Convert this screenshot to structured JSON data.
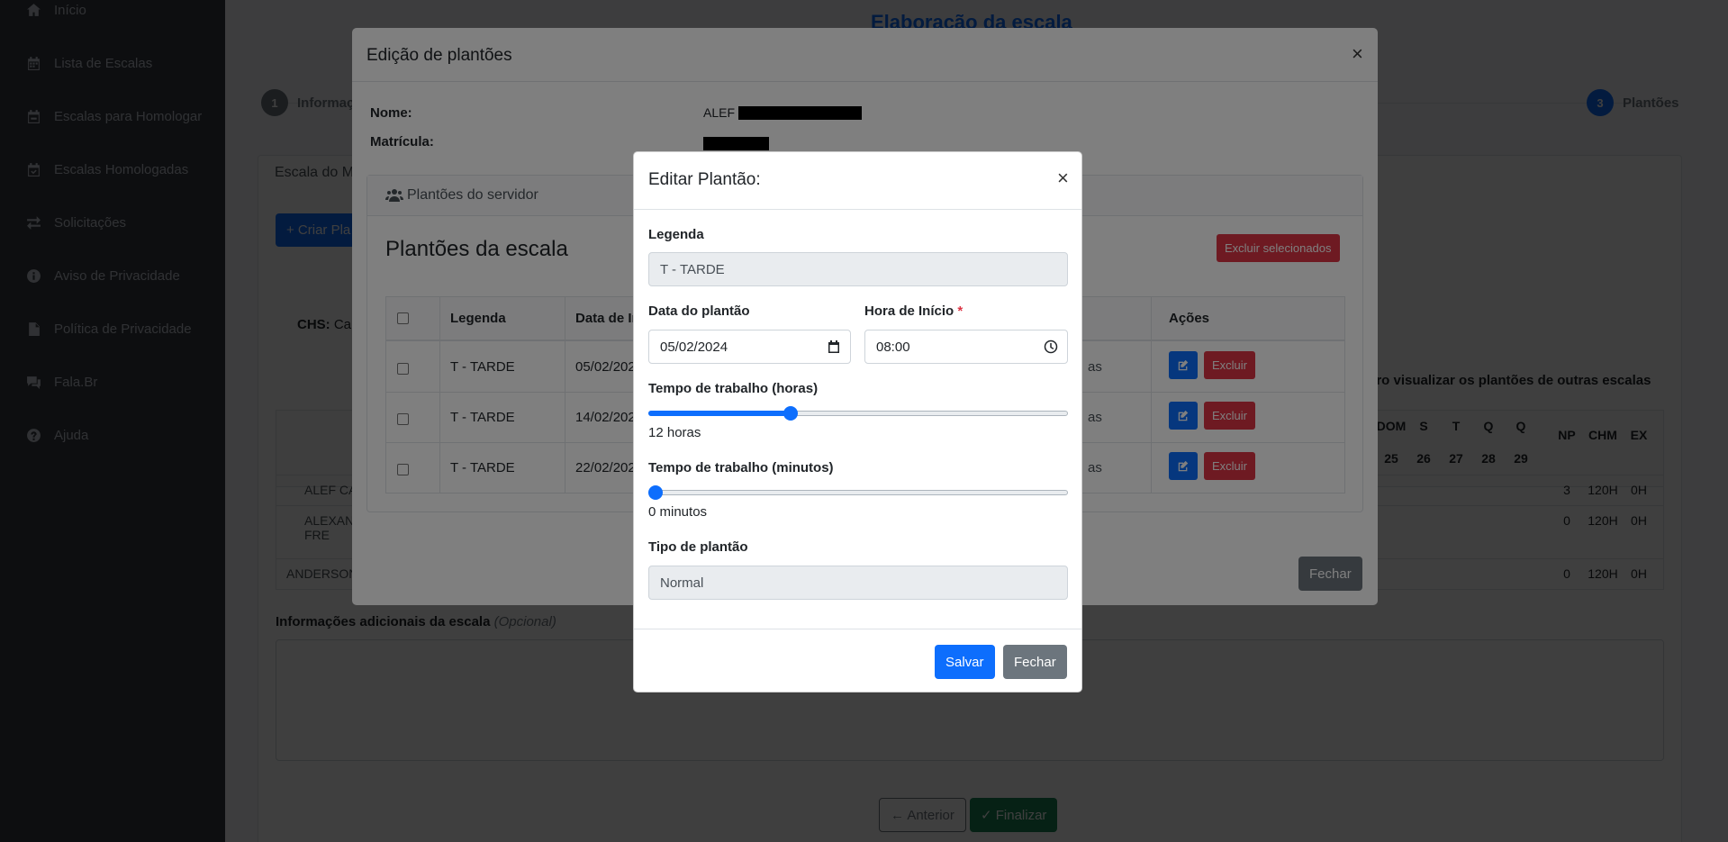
{
  "sidebar": {
    "items": [
      {
        "label": "Início",
        "icon": "home-icon"
      },
      {
        "label": "Lista de Escalas",
        "icon": "calendar-icon"
      },
      {
        "label": "Escalas para Homologar",
        "icon": "calendar-icon"
      },
      {
        "label": "Escalas Homologadas",
        "icon": "calendar-check-icon"
      },
      {
        "label": "Solicitações",
        "icon": "exchange-icon"
      },
      {
        "label": "Aviso de Privacidade",
        "icon": "info-icon"
      },
      {
        "label": "Política de Privacidade",
        "icon": "file-icon"
      },
      {
        "label": "Fala.Br",
        "icon": "comments-icon"
      },
      {
        "label": "Ajuda",
        "icon": "question-icon"
      }
    ]
  },
  "page": {
    "title": "Elaboração da escala",
    "steps": [
      {
        "num": "1",
        "label": "Informações"
      },
      {
        "num": "3",
        "label": "Plantões"
      }
    ],
    "tab": "Escala do M",
    "create_button": "+ Criar Pla",
    "chs_label": "CHS:",
    "chs_value": "Car",
    "other_scales_note": "ero visualizar os plantões de outras escalas",
    "calendar_days": [
      {
        "day": "DOM",
        "date": "25"
      },
      {
        "day": "S",
        "date": "26"
      },
      {
        "day": "T",
        "date": "27"
      },
      {
        "day": "Q",
        "date": "28"
      },
      {
        "day": "Q",
        "date": "29"
      }
    ],
    "summary_headers": [
      "NP",
      "CHM",
      "EX"
    ],
    "rows": [
      {
        "name": "ALEF CA",
        "np": "3",
        "chm": "120H",
        "ex": "0H"
      },
      {
        "name": "ALEXAN\nFRE",
        "np": "0",
        "chm": "120H",
        "ex": "0H"
      },
      {
        "name": "ANDERSON",
        "np": "0",
        "chm": "120H",
        "ex": "0H"
      }
    ],
    "additional_info_label": "Informações adicionais da escala",
    "additional_info_optional": "(Opcional)",
    "prev_button": "← Anterior",
    "finish_button": "✓ Finalizar"
  },
  "edit_modal": {
    "title": "Edição de plantões",
    "close": "×",
    "name_label": "Nome:",
    "name_value": "ALEF",
    "registration_label": "Matrícula:",
    "card_header": "Plantões do servidor",
    "card_title": "Plantões da escala",
    "delete_selected": "Excluir selecionados",
    "columns": [
      "Legenda",
      "Data de In",
      "Ações"
    ],
    "shifts": [
      {
        "legend": "T - TARDE",
        "date": "05/02/202",
        "hours": "as"
      },
      {
        "legend": "T - TARDE",
        "date": "14/02/202",
        "hours": "as"
      },
      {
        "legend": "T - TARDE",
        "date": "22/02/202",
        "hours": "as"
      }
    ],
    "delete_button": "Excluir",
    "close_button": "Fechar"
  },
  "shift_modal": {
    "title": "Editar Plantão:",
    "close": "×",
    "legend_label": "Legenda",
    "legend_value": "T - TARDE",
    "date_label": "Data do plantão",
    "date_value": "05/02/2024",
    "start_label": "Hora de Início",
    "required_mark": "*",
    "start_value": "08:00",
    "hours_label": "Tempo de trabalho (horas)",
    "hours_value": 12,
    "hours_fraction": 0.34,
    "hours_text": "12 horas",
    "minutes_label": "Tempo de trabalho (minutos)",
    "minutes_value": 0,
    "minutes_fraction": 0,
    "minutes_text": "0 minutos",
    "type_label": "Tipo de plantão",
    "type_value": "Normal",
    "save_button": "Salvar",
    "close_button": "Fechar"
  },
  "colors": {
    "primary": "#0d6efd",
    "danger": "#dc3545",
    "secondary": "#6c757d",
    "success": "#198754",
    "sidebar": "#343a40"
  }
}
